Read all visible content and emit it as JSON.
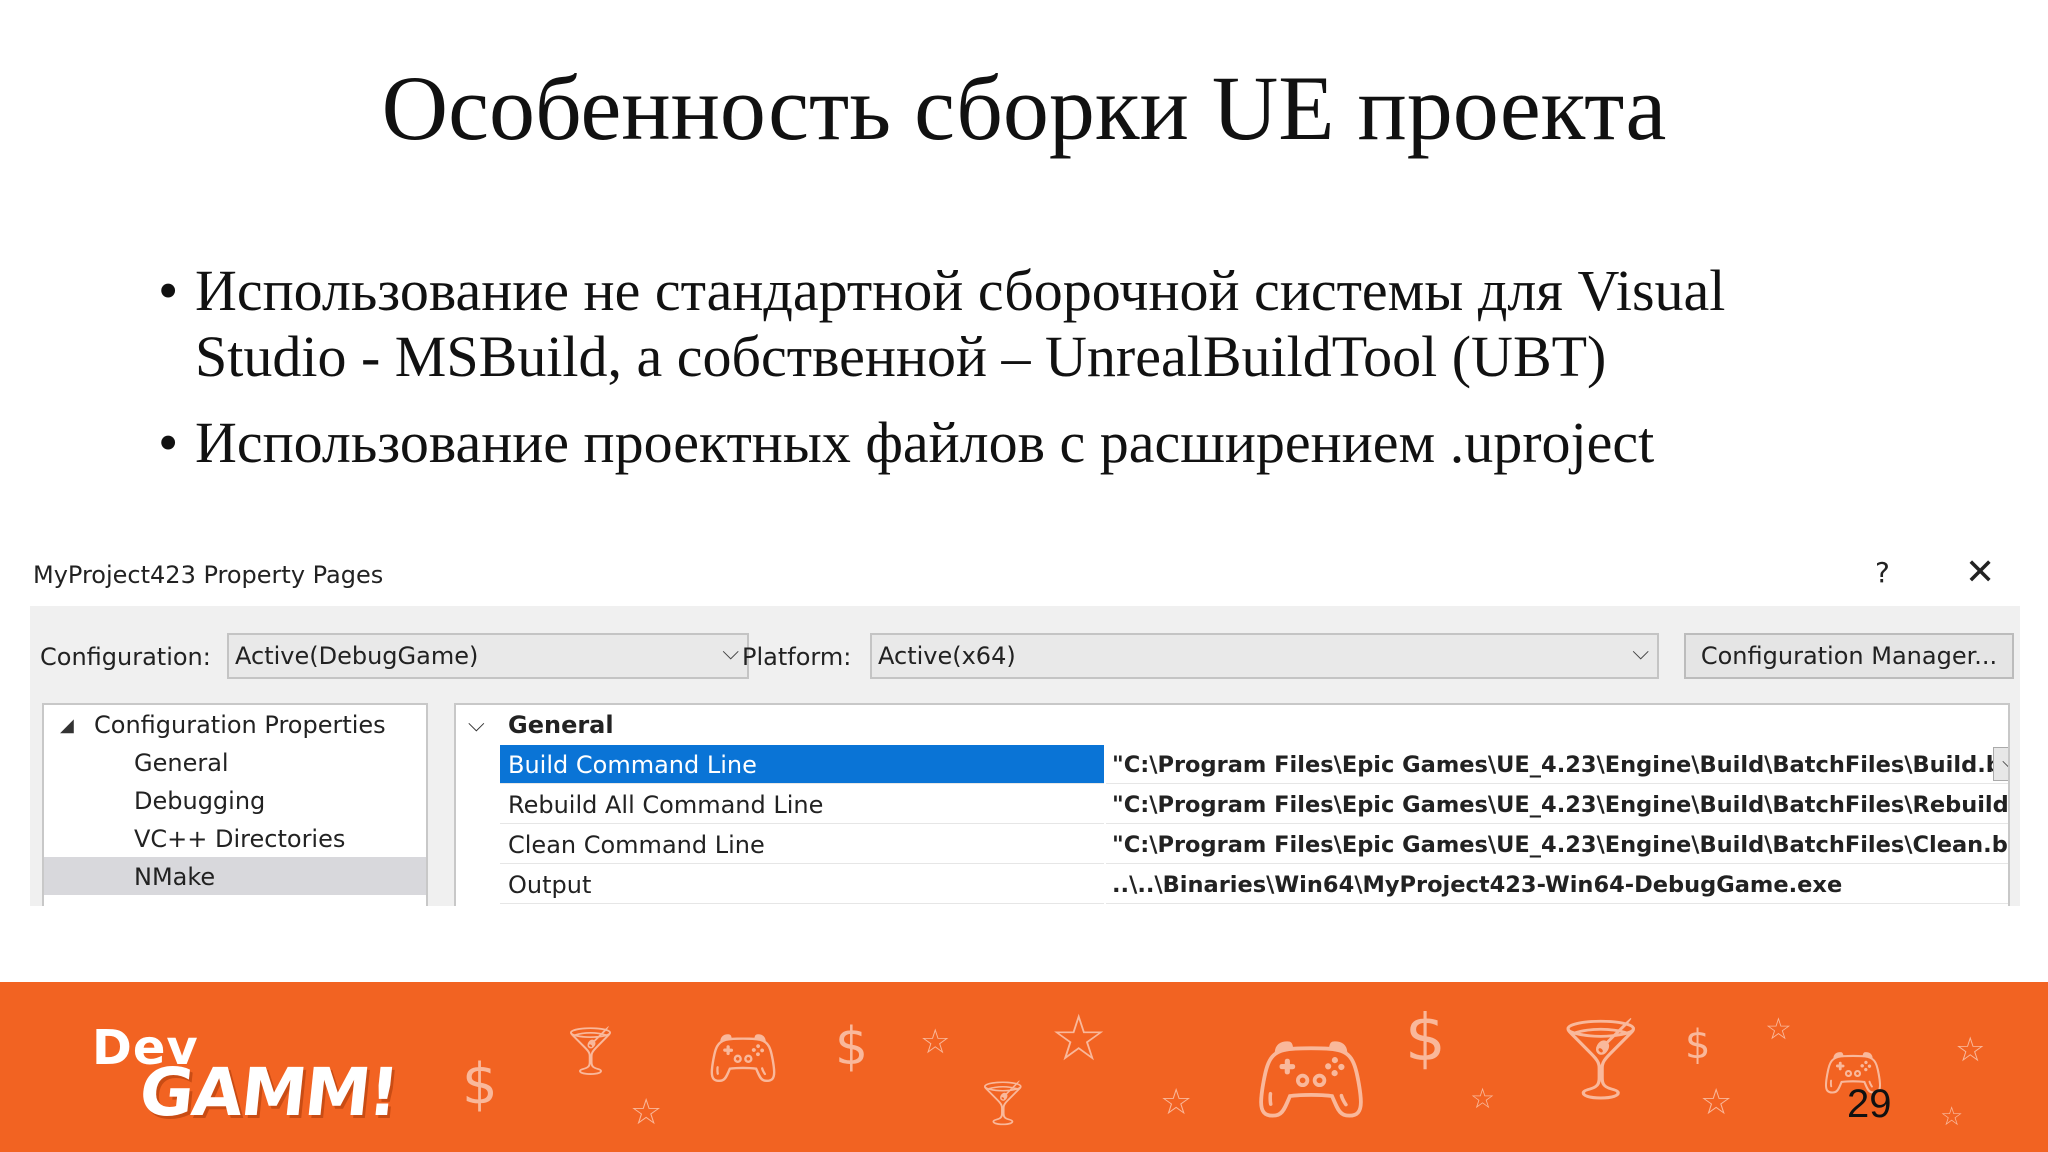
{
  "slide": {
    "title": "Особенность сборки UE проекта",
    "bullets": [
      {
        "line1": "Использование не стандартной сборочной системы для Visual",
        "line2": "Studio - MSBuild, а собственной – UnrealBuildTool (UBT)"
      },
      {
        "line1": "Использование проектных файлов с расширением .uproject",
        "line2": ""
      }
    ],
    "page_number": "29"
  },
  "dialog": {
    "title": "MyProject423 Property Pages",
    "help_label": "?",
    "close_label": "✕",
    "configuration_label": "Configuration:",
    "configuration_value": "Active(DebugGame)",
    "platform_label": "Platform:",
    "platform_value": "Active(x64)",
    "config_manager_label": "Configuration Manager...",
    "tree": {
      "root": "Configuration Properties",
      "items": [
        "General",
        "Debugging",
        "VC++ Directories",
        "NMake"
      ],
      "selected": "NMake"
    },
    "grid": {
      "section": "General",
      "rows": [
        {
          "name": "Build Command Line",
          "value": "\"C:\\Program Files\\Epic Games\\UE_4.23\\Engine\\Build\\BatchFiles\\Build.bat\""
        },
        {
          "name": "Rebuild All Command Line",
          "value": "\"C:\\Program Files\\Epic Games\\UE_4.23\\Engine\\Build\\BatchFiles\\Rebuild.bat\""
        },
        {
          "name": "Clean Command Line",
          "value": "\"C:\\Program Files\\Epic Games\\UE_4.23\\Engine\\Build\\BatchFiles\\Clean.bat\" My"
        },
        {
          "name": "Output",
          "value": "..\\..\\Binaries\\Win64\\MyProject423-Win64-DebugGame.exe"
        }
      ]
    }
  },
  "footer": {
    "logo_top": "Dev",
    "logo_bottom": "GAMM!",
    "accent_color": "#f26322"
  }
}
